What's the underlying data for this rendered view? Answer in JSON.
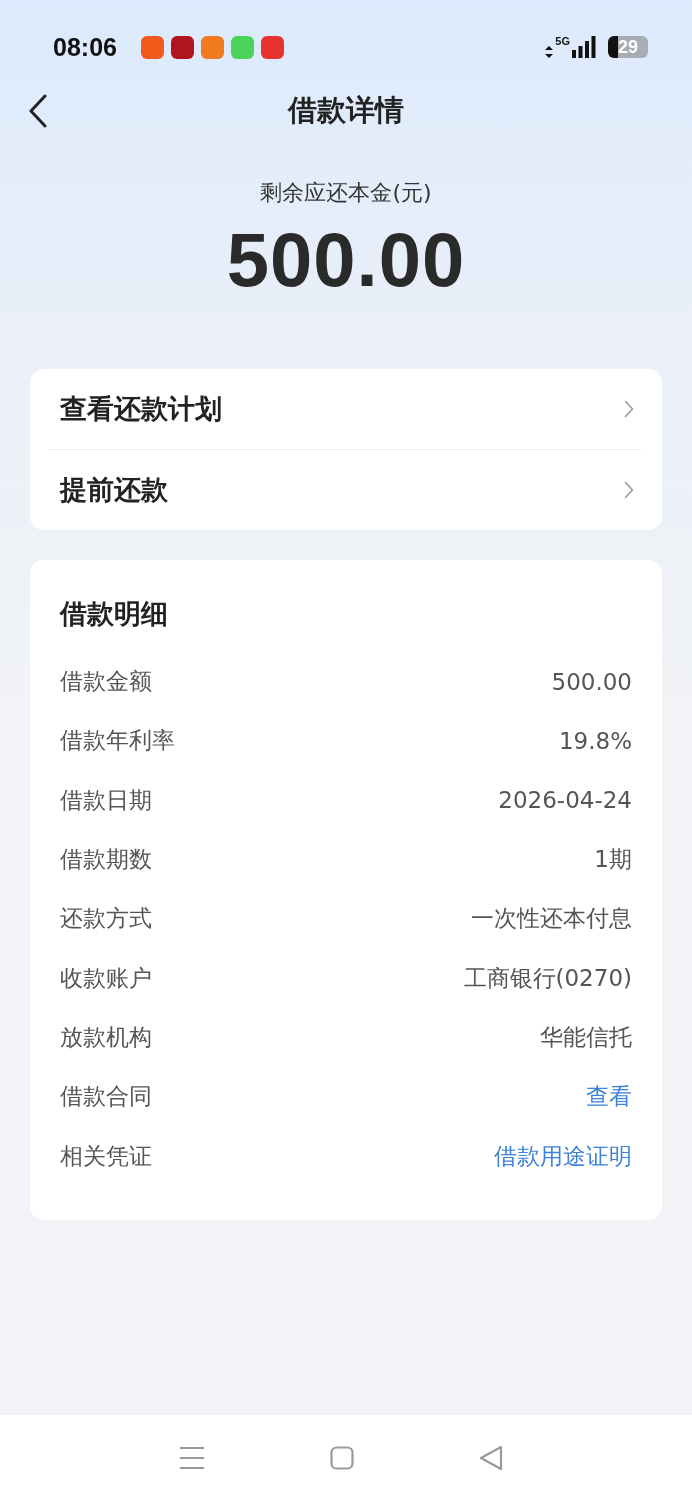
{
  "status_bar": {
    "time": "08:06",
    "app_icons": [
      {
        "color": "#f25a1c"
      },
      {
        "color": "#b0141c"
      },
      {
        "color": "#f07a1e"
      },
      {
        "color": "#4cd35c"
      },
      {
        "color": "#e8322e"
      }
    ],
    "network": "5G",
    "battery": "29"
  },
  "header": {
    "title": "借款详情"
  },
  "summary": {
    "label": "剩余应还本金(元)",
    "amount": "500.00"
  },
  "actions": [
    {
      "label": "查看还款计划"
    },
    {
      "label": "提前还款"
    }
  ],
  "details": {
    "title": "借款明细",
    "rows": [
      {
        "label": "借款金额",
        "value": "500.00",
        "kind": "text"
      },
      {
        "label": "借款年利率",
        "value": "19.8%",
        "kind": "text"
      },
      {
        "label": "借款日期",
        "value": "2026-04-24",
        "kind": "text"
      },
      {
        "label": "借款期数",
        "value": "1期",
        "kind": "text"
      },
      {
        "label": "还款方式",
        "value": "一次性还本付息",
        "kind": "text"
      },
      {
        "label": "收款账户",
        "value": "工商银行(0270)",
        "kind": "text"
      },
      {
        "label": "放款机构",
        "value": "华能信托",
        "kind": "text"
      },
      {
        "label": "借款合同",
        "value": "查看",
        "kind": "link"
      },
      {
        "label": "相关凭证",
        "value": "借款用途证明",
        "kind": "link"
      }
    ]
  }
}
